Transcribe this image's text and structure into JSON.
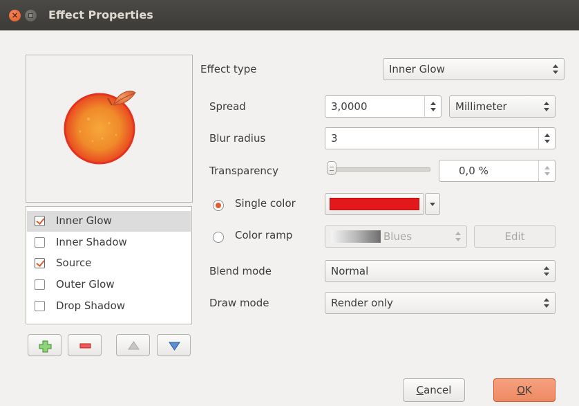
{
  "window": {
    "title": "Effect Properties"
  },
  "preview": {
    "icon": "orange-fruit-icon"
  },
  "effects_list": [
    {
      "label": "Inner Glow",
      "checked": true,
      "selected": true
    },
    {
      "label": "Inner Shadow",
      "checked": false,
      "selected": false
    },
    {
      "label": "Source",
      "checked": true,
      "selected": false
    },
    {
      "label": "Outer Glow",
      "checked": false,
      "selected": false
    },
    {
      "label": "Drop Shadow",
      "checked": false,
      "selected": false
    }
  ],
  "list_tools": {
    "add_icon": "plus-icon",
    "remove_icon": "minus-icon",
    "up_icon": "arrow-up-icon",
    "down_icon": "arrow-down-icon"
  },
  "form": {
    "effect_type": {
      "label": "Effect type",
      "value": "Inner Glow"
    },
    "spread": {
      "label": "Spread",
      "value": "3,0000",
      "unit": "Millimeter"
    },
    "blur_radius": {
      "label": "Blur radius",
      "value": "3"
    },
    "transparency": {
      "label": "Transparency",
      "value": "0,0 %",
      "level": 0
    },
    "single_color": {
      "label": "Single color",
      "selected": true,
      "color": "#e3181b"
    },
    "color_ramp": {
      "label": "Color ramp",
      "selected": false,
      "value": "Blues",
      "edit_label": "Edit"
    },
    "blend_mode": {
      "label": "Blend mode",
      "value": "Normal"
    },
    "draw_mode": {
      "label": "Draw mode",
      "value": "Render only"
    }
  },
  "buttons": {
    "cancel": "Cancel",
    "ok": "OK"
  },
  "colors": {
    "accent": "#e05d2f",
    "titlebar": "#3c3b37",
    "ok_button": "#ee8a64"
  }
}
